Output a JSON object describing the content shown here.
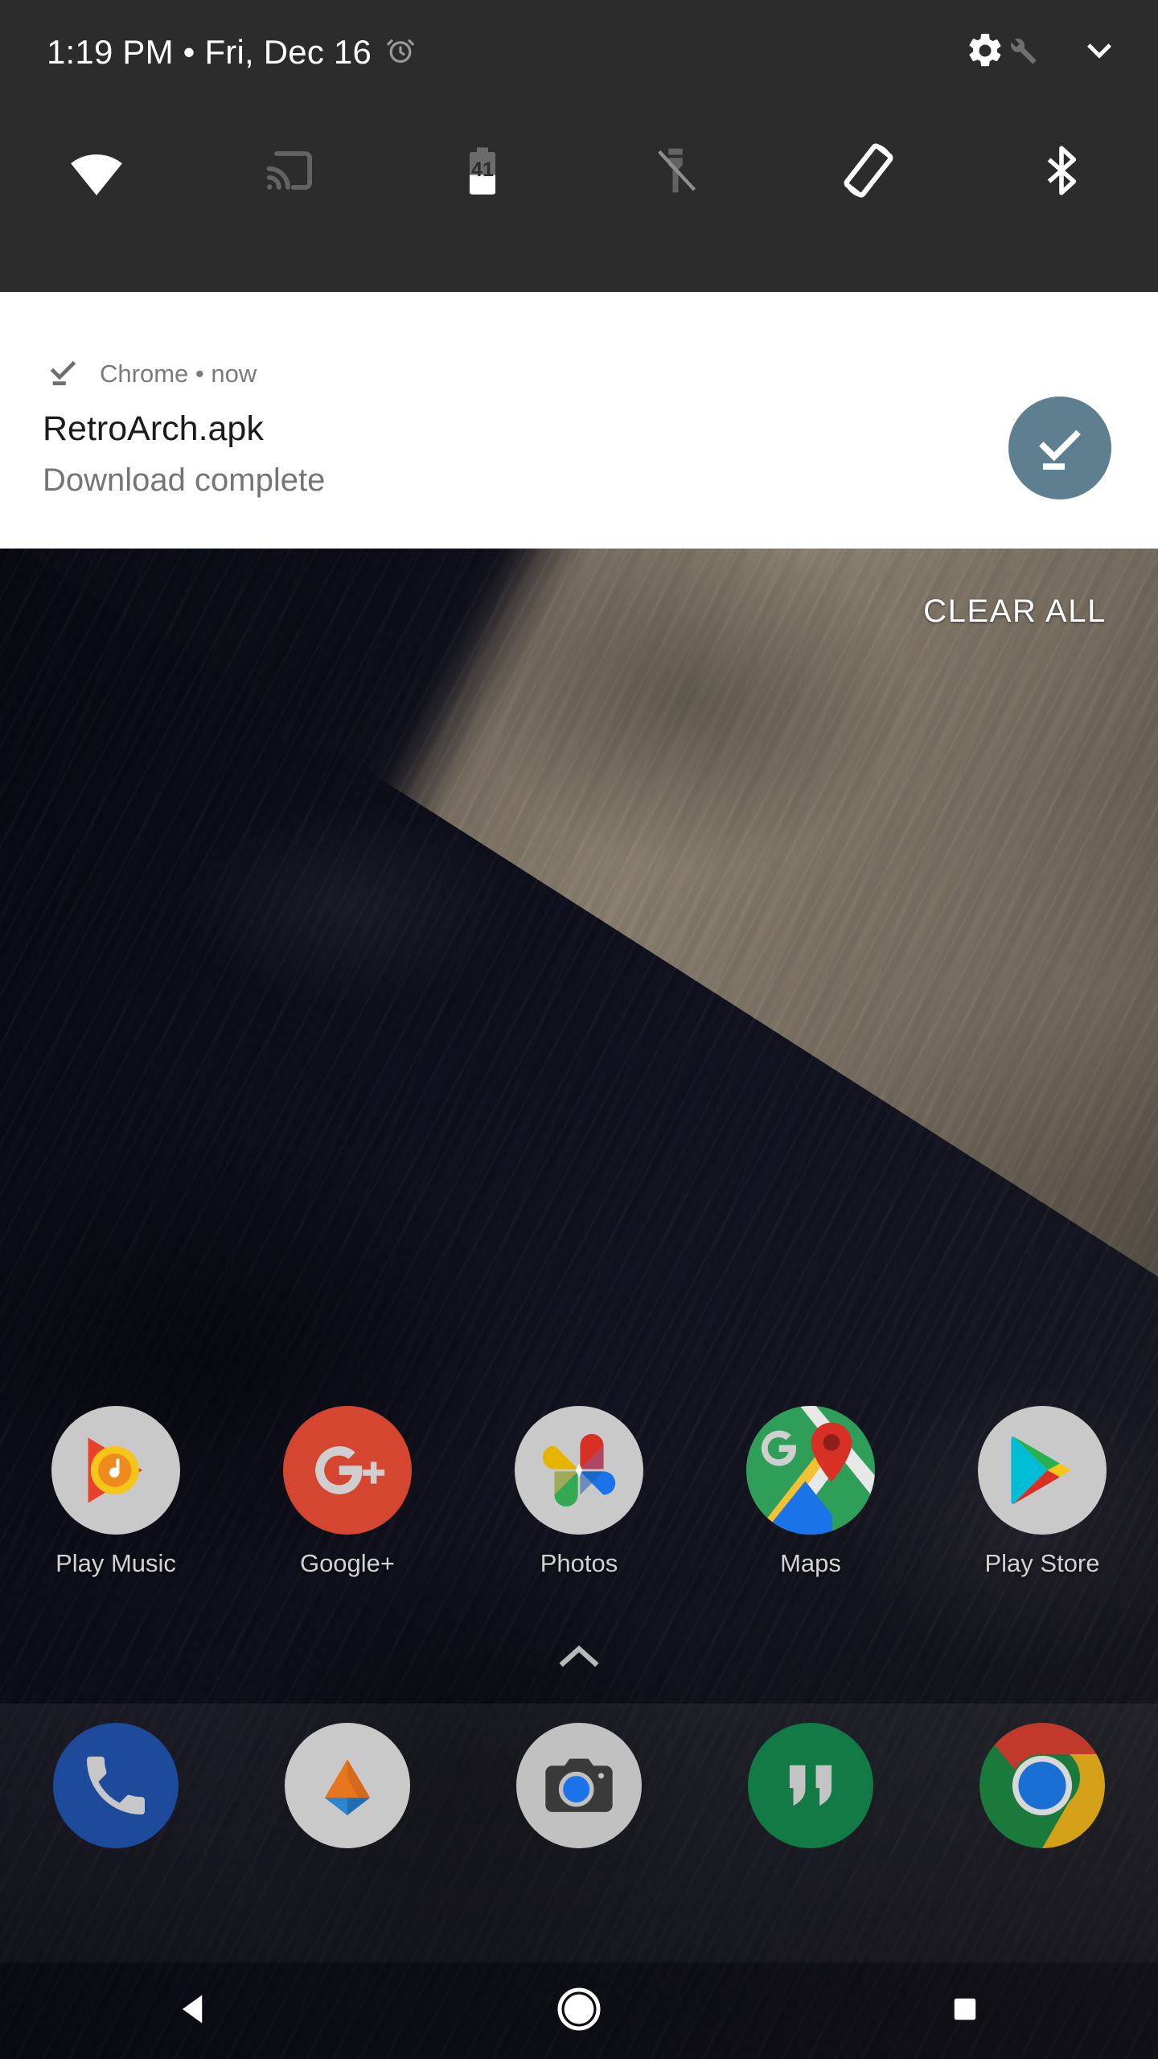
{
  "status_bar": {
    "time": "1:19 PM",
    "separator": "•",
    "date": "Fri, Dec 16",
    "clock_line": "1:19 PM  •  Fri, Dec 16",
    "alarm_icon": "alarm-clock-icon",
    "settings_icon": "gear-icon",
    "tuner_icon": "wrench-icon",
    "expand_icon": "chevron-down-icon"
  },
  "quick_settings": {
    "tiles": [
      {
        "name": "wifi",
        "icon": "wifi-icon",
        "state": "on",
        "label": "Wi-Fi"
      },
      {
        "name": "cast",
        "icon": "cast-icon",
        "state": "off",
        "label": "Cast"
      },
      {
        "name": "battery",
        "icon": "battery-icon",
        "state": "on",
        "label": "Battery",
        "percent": "41"
      },
      {
        "name": "flashlight",
        "icon": "flashlight-off-icon",
        "state": "off",
        "label": "Flashlight"
      },
      {
        "name": "auto-rotate",
        "icon": "screen-rotate-icon",
        "state": "on",
        "label": "Auto-rotate"
      },
      {
        "name": "bluetooth",
        "icon": "bluetooth-icon",
        "state": "on",
        "label": "Bluetooth"
      }
    ]
  },
  "notification": {
    "app_name": "Chrome",
    "separator": "•",
    "time": "now",
    "header_line": "Chrome  •  now",
    "title": "RetroArch.apk",
    "body": "Download complete",
    "small_icon": "download-done-icon",
    "large_icon": "download-done-icon",
    "large_icon_color": "#5d7f8f"
  },
  "shade": {
    "clear_all_label": "CLEAR ALL",
    "scrim_color": "#2c2c2c",
    "card_color": "#ffffff"
  },
  "home_screen": {
    "apps": [
      {
        "label": "Play Music",
        "icon": "play-music-icon"
      },
      {
        "label": "Google+",
        "icon": "google-plus-icon"
      },
      {
        "label": "Photos",
        "icon": "google-photos-icon"
      },
      {
        "label": "Maps",
        "icon": "google-maps-icon"
      },
      {
        "label": "Play Store",
        "icon": "play-store-icon"
      }
    ],
    "drawer_handle_icon": "chevron-up-icon"
  },
  "dock": {
    "apps": [
      {
        "label": "Phone",
        "icon": "phone-icon"
      },
      {
        "label": "Drive",
        "icon": "google-drive-icon"
      },
      {
        "label": "Camera",
        "icon": "camera-icon"
      },
      {
        "label": "Hangouts",
        "icon": "hangouts-icon"
      },
      {
        "label": "Chrome",
        "icon": "chrome-icon"
      }
    ]
  },
  "nav_bar": {
    "buttons": [
      {
        "name": "back",
        "icon": "back-triangle-icon"
      },
      {
        "name": "home",
        "icon": "home-circle-icon"
      },
      {
        "name": "recents",
        "icon": "recents-square-icon"
      }
    ]
  }
}
